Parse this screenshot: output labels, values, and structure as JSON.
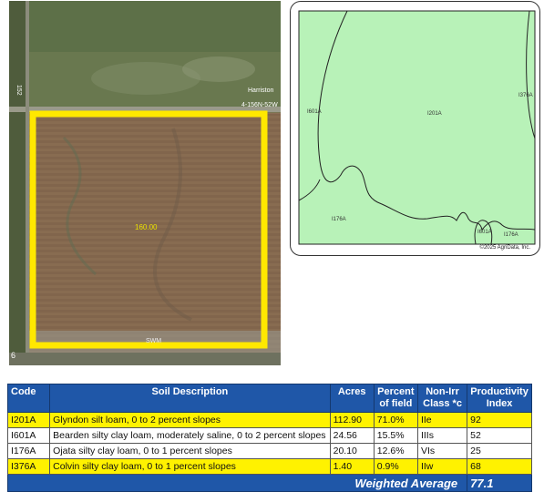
{
  "aerial": {
    "road_label": "Harriston",
    "road_label_2": "4-156N-52W",
    "side_number": "152",
    "field_acres_label": "160.00",
    "bottom_text": "SWM",
    "corner_number": "6"
  },
  "soil_map": {
    "units": [
      {
        "symbol": "I601A"
      },
      {
        "symbol": "I201A"
      },
      {
        "symbol": "I376A"
      },
      {
        "symbol": "I176A"
      },
      {
        "symbol": "I601A"
      },
      {
        "symbol": "I176A"
      }
    ],
    "copyright": "©2025 AgriData, Inc."
  },
  "table": {
    "headers": {
      "code": "Code",
      "description": "Soil Description",
      "acres": "Acres",
      "percent_line1": "Percent",
      "percent_line2": "of field",
      "class_line1": "Non-Irr",
      "class_line2": "Class *c",
      "pi_line1": "Productivity",
      "pi_line2": "Index"
    },
    "rows": [
      {
        "code": "I201A",
        "description": "Glyndon silt loam, 0 to 2 percent slopes",
        "acres": "112.90",
        "percent": "71.0%",
        "class": "IIe",
        "pi": "92"
      },
      {
        "code": "I601A",
        "description": "Bearden silty clay loam, moderately saline, 0 to 2 percent slopes",
        "acres": "24.56",
        "percent": "15.5%",
        "class": "IIIs",
        "pi": "52"
      },
      {
        "code": "I176A",
        "description": "Ojata silty clay loam, 0 to 1 percent slopes",
        "acres": "20.10",
        "percent": "12.6%",
        "class": "VIs",
        "pi": "25"
      },
      {
        "code": "I376A",
        "description": "Colvin silty clay loam, 0 to 1 percent slopes",
        "acres": "1.40",
        "percent": "0.9%",
        "class": "IIw",
        "pi": "68"
      }
    ],
    "weighted_label": "Weighted Average",
    "weighted_value": "77.1"
  },
  "colors": {
    "field_outline": "#ffe800",
    "soil_fill": "#b8f2b8",
    "table_header": "#1f57a8",
    "row_highlight": "#fff200"
  }
}
